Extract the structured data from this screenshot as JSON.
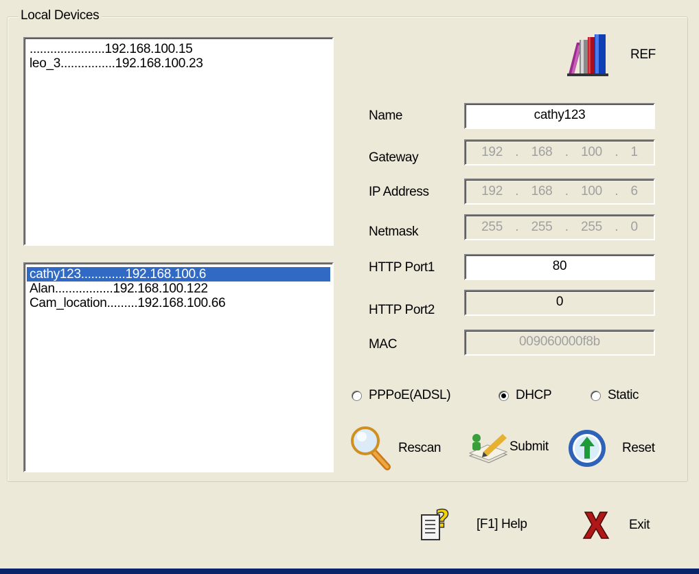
{
  "group_title": "Local Devices",
  "upper_list": [
    "......................192.168.100.15",
    "leo_3................192.168.100.23"
  ],
  "lower_list": [
    {
      "text": "cathy123.............192.168.100.6",
      "selected": true
    },
    {
      "text": "Alan.................192.168.100.122",
      "selected": false
    },
    {
      "text": "Cam_location.........192.168.100.66",
      "selected": false
    }
  ],
  "ref_label": "REF",
  "fields": {
    "name_label": "Name",
    "name_value": "cathy123",
    "gateway_label": "Gateway",
    "gateway": [
      "192",
      "168",
      "100",
      "1"
    ],
    "ip_label": "IP Address",
    "ip": [
      "192",
      "168",
      "100",
      "6"
    ],
    "netmask_label": "Netmask",
    "netmask": [
      "255",
      "255",
      "255",
      "0"
    ],
    "port1_label": "HTTP Port1",
    "port1_value": "80",
    "port2_label": "HTTP Port2",
    "port2_value": "0",
    "mac_label": "MAC",
    "mac_value": "009060000f8b"
  },
  "radios": {
    "pppoe": "PPPoE(ADSL)",
    "dhcp": "DHCP",
    "static": "Static",
    "selected": "dhcp"
  },
  "buttons": {
    "rescan": "Rescan",
    "submit": "Submit",
    "reset": "Reset",
    "help": "[F1] Help",
    "exit": "Exit"
  },
  "colors": {
    "selection": "#316AC5",
    "window_bg": "#ECE9D8"
  }
}
